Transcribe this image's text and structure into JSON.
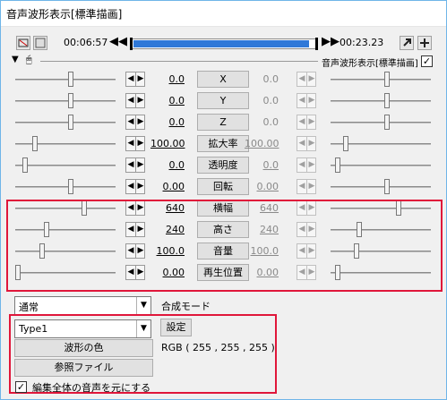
{
  "window": {
    "title": "音声波形表示[標準描画]"
  },
  "timeline": {
    "current_time": "00:06:57",
    "end_time": "00:23.23",
    "progress": 0.97,
    "prev_label": "◀◀",
    "next_label": "▶▶"
  },
  "object_header": {
    "label": "音声波形表示[標準描画]",
    "enabled": true,
    "checkbox_mark": "✓"
  },
  "params": [
    {
      "name": "X",
      "start": "0.0",
      "end": "0.0",
      "end_underlined": false
    },
    {
      "name": "Y",
      "start": "0.0",
      "end": "0.0",
      "end_underlined": false
    },
    {
      "name": "Z",
      "start": "0.0",
      "end": "0.0",
      "end_underlined": false
    },
    {
      "name": "拡大率",
      "start": "100.00",
      "end": "100.00",
      "end_underlined": true
    },
    {
      "name": "透明度",
      "start": "0.0",
      "end": "0.0",
      "end_underlined": true
    },
    {
      "name": "回転",
      "start": "0.00",
      "end": "0.00",
      "end_underlined": true
    },
    {
      "name": "横幅",
      "start": "640",
      "end": "640",
      "end_underlined": true
    },
    {
      "name": "高さ",
      "start": "240",
      "end": "240",
      "end_underlined": true
    },
    {
      "name": "音量",
      "start": "100.0",
      "end": "100.0",
      "end_underlined": true
    },
    {
      "name": "再生位置",
      "start": "0.00",
      "end": "0.00",
      "end_underlined": true
    }
  ],
  "blend": {
    "value": "通常",
    "label": "合成モード"
  },
  "type": {
    "value": "Type1",
    "settings_button": "設定"
  },
  "wave_color": {
    "button": "波形の色",
    "value": "RGB ( 255 , 255 , 255 )"
  },
  "reference_file": {
    "button": "参照ファイル"
  },
  "use_whole_audio": {
    "label": "編集全体の音声を元にする",
    "checked": true,
    "mark": "✓"
  },
  "colors": {
    "highlight": "#e0163a",
    "seek_fill": "#2f78d8"
  }
}
